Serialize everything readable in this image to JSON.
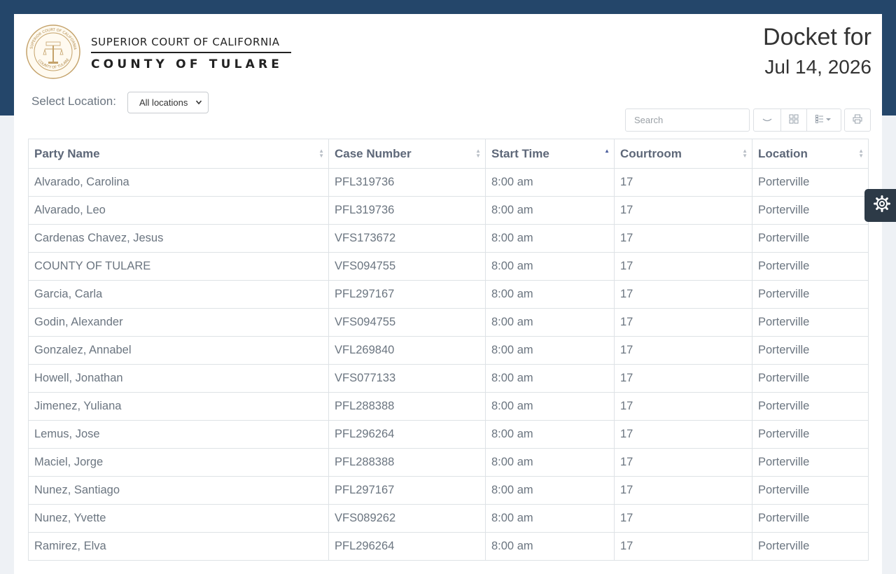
{
  "header": {
    "court_line1": "SUPERIOR COURT OF CALIFORNIA",
    "court_line2": "COUNTY OF TULARE",
    "docket_title": "Docket for",
    "docket_date": "Jul 14, 2026",
    "seal_text_top": "SUPERIOR COURT OF CALIFORNIA",
    "seal_text_bottom": "COUNTY OF TULARE"
  },
  "filters": {
    "location_label": "Select Location:",
    "location_selected": "All locations"
  },
  "toolbar": {
    "search_placeholder": "Search",
    "icons": [
      "chevron-down-icon",
      "grid-view-icon",
      "columns-icon",
      "print-icon"
    ]
  },
  "table": {
    "columns": [
      {
        "label": "Party Name",
        "sort": "none"
      },
      {
        "label": "Case Number",
        "sort": "none"
      },
      {
        "label": "Start Time",
        "sort": "asc"
      },
      {
        "label": "Courtroom",
        "sort": "none"
      },
      {
        "label": "Location",
        "sort": "none"
      }
    ],
    "rows": [
      [
        "Alvarado, Carolina",
        "PFL319736",
        "8:00 am",
        "17",
        "Porterville"
      ],
      [
        "Alvarado, Leo",
        "PFL319736",
        "8:00 am",
        "17",
        "Porterville"
      ],
      [
        "Cardenas Chavez, Jesus",
        "VFS173672",
        "8:00 am",
        "17",
        "Porterville"
      ],
      [
        "COUNTY OF TULARE",
        "VFS094755",
        "8:00 am",
        "17",
        "Porterville"
      ],
      [
        "Garcia, Carla",
        "PFL297167",
        "8:00 am",
        "17",
        "Porterville"
      ],
      [
        "Godin, Alexander",
        "VFS094755",
        "8:00 am",
        "17",
        "Porterville"
      ],
      [
        "Gonzalez, Annabel",
        "VFL269840",
        "8:00 am",
        "17",
        "Porterville"
      ],
      [
        "Howell, Jonathan",
        "VFS077133",
        "8:00 am",
        "17",
        "Porterville"
      ],
      [
        "Jimenez, Yuliana",
        "PFL288388",
        "8:00 am",
        "17",
        "Porterville"
      ],
      [
        "Lemus, Jose",
        "PFL296264",
        "8:00 am",
        "17",
        "Porterville"
      ],
      [
        "Maciel, Jorge",
        "PFL288388",
        "8:00 am",
        "17",
        "Porterville"
      ],
      [
        "Nunez, Santiago",
        "PFL297167",
        "8:00 am",
        "17",
        "Porterville"
      ],
      [
        "Nunez, Yvette",
        "VFS089262",
        "8:00 am",
        "17",
        "Porterville"
      ],
      [
        "Ramirez, Elva",
        "PFL296264",
        "8:00 am",
        "17",
        "Porterville"
      ]
    ]
  },
  "colors": {
    "header_band": "#24466a",
    "page_bg": "#eef1f5",
    "seal_gold": "#c4a26a",
    "settings_tab": "#2d3a47"
  }
}
